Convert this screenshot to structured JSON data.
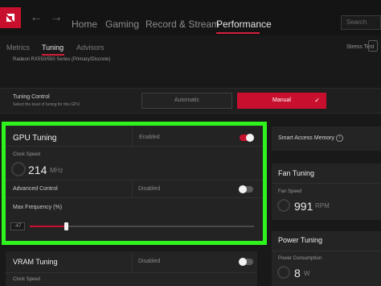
{
  "nav": {
    "items": [
      "Home",
      "Gaming",
      "Record & Stream",
      "Performance"
    ],
    "active": "Performance",
    "search_placeholder": "Search"
  },
  "subtabs": {
    "items": [
      "Metrics",
      "Tuning",
      "Advisors"
    ],
    "active": "Tuning",
    "stress_test": "Stress Test"
  },
  "device": {
    "name": "Radeon RX550/550 Series (Primary/Discrete)"
  },
  "tuning_control": {
    "title": "Tuning Control",
    "description": "Select the level of tuning for this GPU",
    "automatic_label": "Automatic",
    "manual_label": "Manual",
    "selected": "Manual"
  },
  "gpu_tuning": {
    "title": "GPU Tuning",
    "status": "Enabled",
    "enabled": true,
    "clock_speed_label": "Clock Speed",
    "clock_speed_value": "214",
    "clock_speed_unit": "MHz",
    "advanced_control_label": "Advanced Control",
    "advanced_control_status": "Disabled",
    "advanced_control_enabled": false,
    "max_frequency_label": "Max Frequency (%)",
    "max_frequency_value": "-47",
    "max_frequency_slider_fraction": 0.16
  },
  "smart_access_memory": {
    "label": "Smart Access Memory"
  },
  "fan_tuning": {
    "title": "Fan Tuning",
    "fan_speed_label": "Fan Speed",
    "fan_speed_value": "991",
    "fan_speed_unit": "RPM"
  },
  "power_tuning": {
    "title": "Power Tuning",
    "power_consumption_label": "Power Consumption",
    "power_value": "8",
    "power_unit": "W"
  },
  "vram_tuning": {
    "title": "VRAM Tuning",
    "status": "Disabled",
    "enabled": false,
    "clock_speed_label": "Clock Speed"
  },
  "colors": {
    "accent": "#c8102e",
    "highlight": "#2ef31c",
    "background": "#191919"
  },
  "icons": [
    "amd-logo-icon",
    "back-arrow-icon",
    "forward-arrow-icon",
    "check-icon",
    "info-icon",
    "gauge-icon"
  ]
}
